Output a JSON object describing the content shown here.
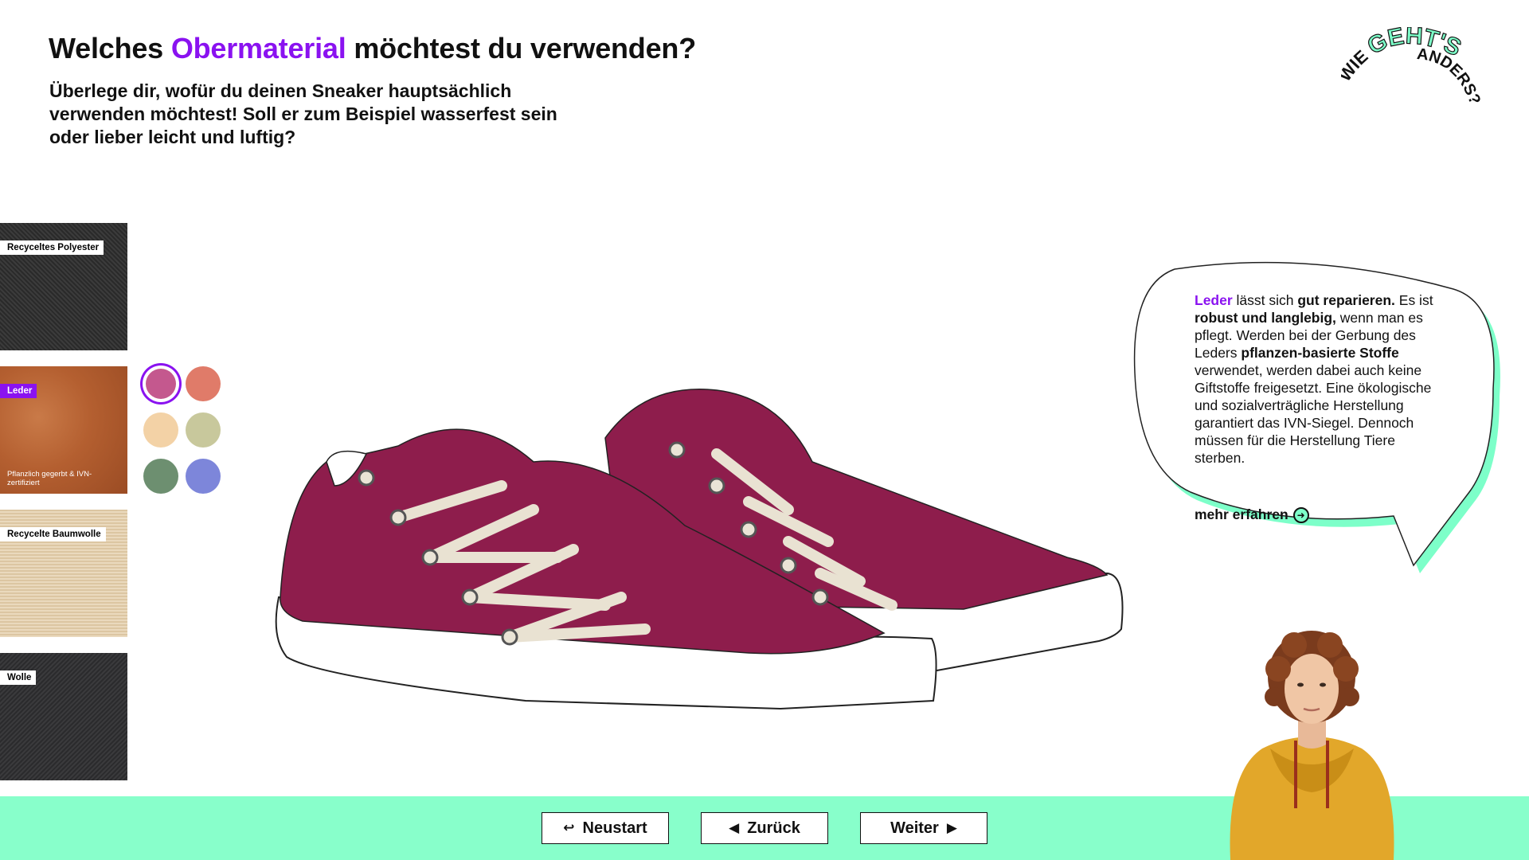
{
  "header": {
    "title_pre": "Welches ",
    "title_accent": "Obermaterial",
    "title_post": " möchtest du verwenden?",
    "subtitle": "Überlege dir, wofür du deinen Sneaker hauptsächlich verwenden möchtest! Soll er zum Beispiel wasserfest sein oder lieber leicht und luftig?"
  },
  "logo": {
    "word1": "WIE",
    "word2": "GEHT'S",
    "word3": "ANDERS?"
  },
  "materials": [
    {
      "label": "Recyceltes Polyester",
      "note": "",
      "active": false
    },
    {
      "label": "Leder",
      "note": "Pflanzlich gegerbt & IVN-zertifiziert",
      "active": true
    },
    {
      "label": "Recycelte Baumwolle",
      "note": "",
      "active": false
    },
    {
      "label": "Wolle",
      "note": "",
      "active": false
    }
  ],
  "swatches": [
    {
      "color": "#c4588e",
      "selected": true
    },
    {
      "color": "#e07b69",
      "selected": false
    },
    {
      "color": "#f3d2a6",
      "selected": false
    },
    {
      "color": "#c8c89c",
      "selected": false
    },
    {
      "color": "#6d8f70",
      "selected": false
    },
    {
      "color": "#7d86da",
      "selected": false
    }
  ],
  "shoe": {
    "upper_color": "#8e1d4c",
    "lace_color": "#e9e2d2"
  },
  "info": {
    "lead": "Leder",
    "t1": " lässt sich ",
    "b1": "gut reparieren.",
    "t2": " Es ist ",
    "b2": "robust und langlebig,",
    "t3": " wenn man es pflegt. Werden bei der Gerbung des Leders ",
    "b3": "pflanzen-basierte Stoffe",
    "t4": " verwendet, werden dabei auch keine Giftstoffe freigesetzt. Eine ökologische und sozialverträgliche Herstellung garantiert das IVN-Siegel. Dennoch müssen für die Herstellung Tiere sterben.",
    "more_label": "mehr erfahren",
    "more_icon": "arrow-right-circle-icon"
  },
  "nav": {
    "restart_label": "Neustart",
    "back_label": "Zurück",
    "next_label": "Weiter",
    "restart_icon": "↩",
    "back_icon": "◀",
    "next_icon": "▶"
  },
  "colors": {
    "accent": "#8a12f0",
    "mint": "#88ffcb"
  }
}
